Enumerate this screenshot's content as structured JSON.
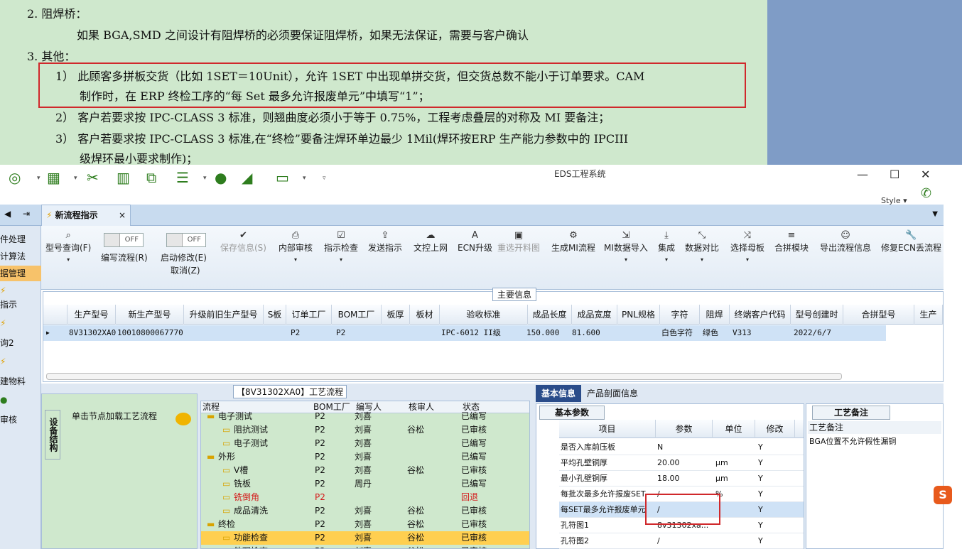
{
  "doc": {
    "l1": "2. 阻焊桥：",
    "l2": "如果 BGA,SMD 之间设计有阻焊桥的必须要保证阻焊桥，如果无法保证，需要与客户确认",
    "l3": "3. 其他：",
    "l4": "1） 此顾客多拼板交货（比如 1SET＝10Unit），允许 1SET 中出现单拼交货，但交货总数不能小于订单要求。CAM",
    "l5": "制作时，在 ERP 终检工序的“每 Set 最多允许报废单元”中填写“1”；",
    "l6": "2） 客户若要求按 IPC-CLASS 3 标准，则翘曲度必须小于等于 0.75%，工程考虑叠层的对称及 MI 要备注；",
    "l7": "3） 客户若要求按 IPC-CLASS 3 标准,在“终检”要备注焊环单边最少 1Mil(焊环按ERP 生产能力参数中的 IPCIII",
    "l8": "级焊环最小要求制作)；"
  },
  "app": {
    "title": "EDS工程系统",
    "style_label": "Style",
    "tab": "新流程指示",
    "ribbon": [
      {
        "label": "型号查询(F)",
        "icon": "search-icon"
      },
      {
        "label": "编写流程(R)",
        "icon": "toggle"
      },
      {
        "label": "启动修改(E)",
        "icon": "toggle"
      },
      {
        "label": "取消(Z)",
        "icon": ""
      },
      {
        "label": "保存信息(S)",
        "icon": "check-icon"
      },
      {
        "label": "内部审核",
        "icon": "print-icon"
      },
      {
        "label": "指示检查",
        "icon": "checkbox-icon"
      },
      {
        "label": "发送指示",
        "icon": "upload-icon"
      },
      {
        "label": "文控上网",
        "icon": "cloud-icon"
      },
      {
        "label": "ECN升级",
        "icon": "a-icon"
      },
      {
        "label": "重选开料图",
        "icon": "image-icon"
      },
      {
        "label": "生成MI流程",
        "icon": "cogs-icon"
      },
      {
        "label": "MI数据导入",
        "icon": "import-icon"
      },
      {
        "label": "集成",
        "icon": "download-icon"
      },
      {
        "label": "数据对比",
        "icon": "compress-icon"
      },
      {
        "label": "选择母板",
        "icon": "shuffle-icon"
      },
      {
        "label": "合拼模块",
        "icon": "list-icon"
      },
      {
        "label": "导出流程信息",
        "icon": "smile-icon"
      },
      {
        "label": "修复ECN丢流程",
        "icon": "wrench-icon"
      }
    ],
    "toggle_off": "OFF",
    "side": [
      "件处理",
      "计算法",
      "据管理",
      "指示",
      "询2",
      "建物料",
      "审核"
    ],
    "main_info": "主要信息",
    "grid_headers": [
      "生产型号",
      "新生产型号",
      "升级前旧生产型号",
      "S板",
      "订单工厂",
      "BOM工厂",
      "板厚",
      "板材",
      "验收标准",
      "成品长度",
      "成品宽度",
      "PNL规格",
      "字符",
      "阻焊",
      "终端客户代码",
      "型号创建时",
      "合拼型号",
      "生产"
    ],
    "grid_row": [
      "8V31302XA0",
      "10010800067770",
      "",
      "",
      "P2",
      "P2",
      "",
      "",
      "IPC-6012 II级",
      "150.000",
      "81.600",
      "",
      "白色字符",
      "绿色",
      "V313",
      "2022/6/7"
    ],
    "flow_title": "【8V31302XA0】工艺流程",
    "vtab": "设备结构",
    "click_node": "单击节点加载工艺流程",
    "tree_headers": [
      "流程",
      "BOM工厂",
      "编写人",
      "核审人",
      "状态"
    ],
    "tree_rows": [
      {
        "name": "电子测试",
        "bom": "P2",
        "writer": "刘喜",
        "reviewer": "",
        "status": "已编写",
        "level": 1
      },
      {
        "name": "阻抗测试",
        "bom": "P2",
        "writer": "刘喜",
        "reviewer": "谷松",
        "status": "已审核",
        "level": 2
      },
      {
        "name": "电子测试",
        "bom": "P2",
        "writer": "刘喜",
        "reviewer": "",
        "status": "已编写",
        "level": 2
      },
      {
        "name": "外形",
        "bom": "P2",
        "writer": "刘喜",
        "reviewer": "",
        "status": "已编写",
        "level": 1
      },
      {
        "name": "V槽",
        "bom": "P2",
        "writer": "刘喜",
        "reviewer": "谷松",
        "status": "已审核",
        "level": 2
      },
      {
        "name": "铣板",
        "bom": "P2",
        "writer": "周丹",
        "reviewer": "",
        "status": "已编写",
        "level": 2
      },
      {
        "name": "铣倒角",
        "bom": "P2",
        "writer": "",
        "reviewer": "",
        "status": "回退",
        "level": 2
      },
      {
        "name": "成品清洗",
        "bom": "P2",
        "writer": "刘喜",
        "reviewer": "谷松",
        "status": "已审核",
        "level": 2
      },
      {
        "name": "终检",
        "bom": "P2",
        "writer": "刘喜",
        "reviewer": "谷松",
        "status": "已审核",
        "level": 1
      },
      {
        "name": "功能检查",
        "bom": "P2",
        "writer": "刘喜",
        "reviewer": "谷松",
        "status": "已审核",
        "level": 2
      },
      {
        "name": "外观检查",
        "bom": "P2",
        "writer": "刘喜",
        "reviewer": "谷松",
        "status": "已审核",
        "level": 2
      }
    ],
    "rtab1": "基本信息",
    "rtab2": "产品剖面信息",
    "basic_tab": "基本参数",
    "basic_headers": [
      "项目",
      "参数",
      "单位",
      "修改"
    ],
    "basic_rows": [
      {
        "item": "是否入库前压板",
        "param": "N",
        "unit": "",
        "mod": "Y"
      },
      {
        "item": "平均孔壁铜厚",
        "param": "20.00",
        "unit": "μm",
        "mod": "Y"
      },
      {
        "item": "最小孔壁铜厚",
        "param": "18.00",
        "unit": "μm",
        "mod": "Y"
      },
      {
        "item": "每批次最多允许报废SET",
        "param": "/",
        "unit": "%",
        "mod": "Y"
      },
      {
        "item": "每SET最多允许报废单元",
        "param": "/",
        "unit": "",
        "mod": "Y"
      },
      {
        "item": "孔符图1",
        "param": "8v31302xa...",
        "unit": "",
        "mod": "Y"
      },
      {
        "item": "孔符图2",
        "param": "/",
        "unit": "",
        "mod": "Y"
      }
    ],
    "notes_tab": "工艺备注",
    "notes_header": "工艺备注",
    "notes_text": "BGA位置不允许假性漏铜"
  }
}
